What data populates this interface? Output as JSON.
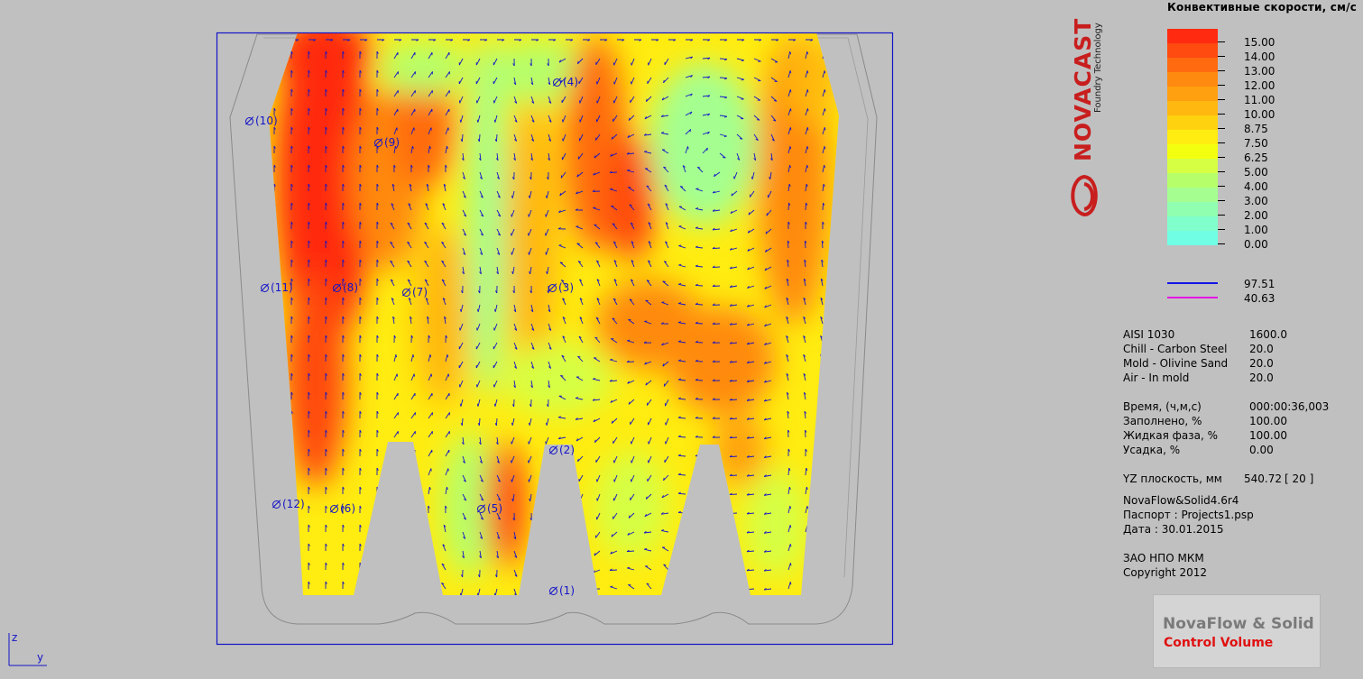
{
  "simulation": {
    "probes": [
      {
        "id": "probe-1",
        "label": "(1)"
      },
      {
        "id": "probe-2",
        "label": "(2)"
      },
      {
        "id": "probe-3",
        "label": "(3)"
      },
      {
        "id": "probe-4",
        "label": "(4)"
      },
      {
        "id": "probe-5",
        "label": "(5)"
      },
      {
        "id": "probe-6",
        "label": "(6)"
      },
      {
        "id": "probe-7",
        "label": "(7)"
      },
      {
        "id": "probe-8",
        "label": "(8)"
      },
      {
        "id": "probe-9",
        "label": "(9)"
      },
      {
        "id": "probe-10",
        "label": "(10)"
      },
      {
        "id": "probe-11",
        "label": "(11)"
      },
      {
        "id": "probe-12",
        "label": "(12)"
      }
    ],
    "axes": {
      "z": "z",
      "y": "y"
    },
    "colors": {
      "frame": "#1414c8",
      "mold_outline": "#8a8a8a",
      "vector": "#1414c8"
    }
  },
  "logo": {
    "name": "NOVACAST",
    "tagline": "Foundry Technology",
    "color": "#c81e1e"
  },
  "legend": {
    "title": "Конвективные скорости, см/с",
    "levels": [
      {
        "value": "15.00",
        "color": "#ff2a10"
      },
      {
        "value": "14.00",
        "color": "#ff4a10"
      },
      {
        "value": "13.00",
        "color": "#ff6a10"
      },
      {
        "value": "12.00",
        "color": "#ff8a10"
      },
      {
        "value": "11.00",
        "color": "#ffa010"
      },
      {
        "value": "10.00",
        "color": "#ffb810"
      },
      {
        "value": "8.75",
        "color": "#ffd210"
      },
      {
        "value": "7.50",
        "color": "#ffec10"
      },
      {
        "value": "6.25",
        "color": "#f4ff10"
      },
      {
        "value": "5.00",
        "color": "#d6ff44"
      },
      {
        "value": "4.00",
        "color": "#b6ff6a"
      },
      {
        "value": "3.00",
        "color": "#a4ff90"
      },
      {
        "value": "2.00",
        "color": "#90ffb0"
      },
      {
        "value": "1.00",
        "color": "#80ffcc"
      },
      {
        "value": "0.00",
        "color": "#70ffe4"
      }
    ],
    "lines": [
      {
        "value": "97.51",
        "color": "#1414e8"
      },
      {
        "value": "40.63",
        "color": "#e414e4"
      }
    ]
  },
  "materials": [
    {
      "name": "AISI 1030",
      "temp": "1600.0"
    },
    {
      "name": "Chill - Carbon Steel",
      "temp": "20.0"
    },
    {
      "name": "Mold - Olivine Sand",
      "temp": "20.0"
    },
    {
      "name": "Air - In mold",
      "temp": "20.0"
    }
  ],
  "status": [
    {
      "label": "Время, (ч,м,с)",
      "value": "000:00:36,003"
    },
    {
      "label": "Заполнено, %",
      "value": "100.00"
    },
    {
      "label": "Жидкая фаза, %",
      "value": "100.00"
    },
    {
      "label": "Усадка, %",
      "value": "0.00"
    }
  ],
  "plane": {
    "label": "YZ плоскость, мм",
    "value": "540.72",
    "index": "[ 20 ]"
  },
  "project": {
    "software": "NovaFlow&Solid4.6r4",
    "passport": "Паспорт : Projects1.psp",
    "date": "Дата : 30.01.2015"
  },
  "company": {
    "name": "ЗАО НПО МКМ",
    "copyright": "Copyright 2012"
  },
  "brand": {
    "line1": "NovaFlow & Solid",
    "line2": "Control Volume"
  }
}
